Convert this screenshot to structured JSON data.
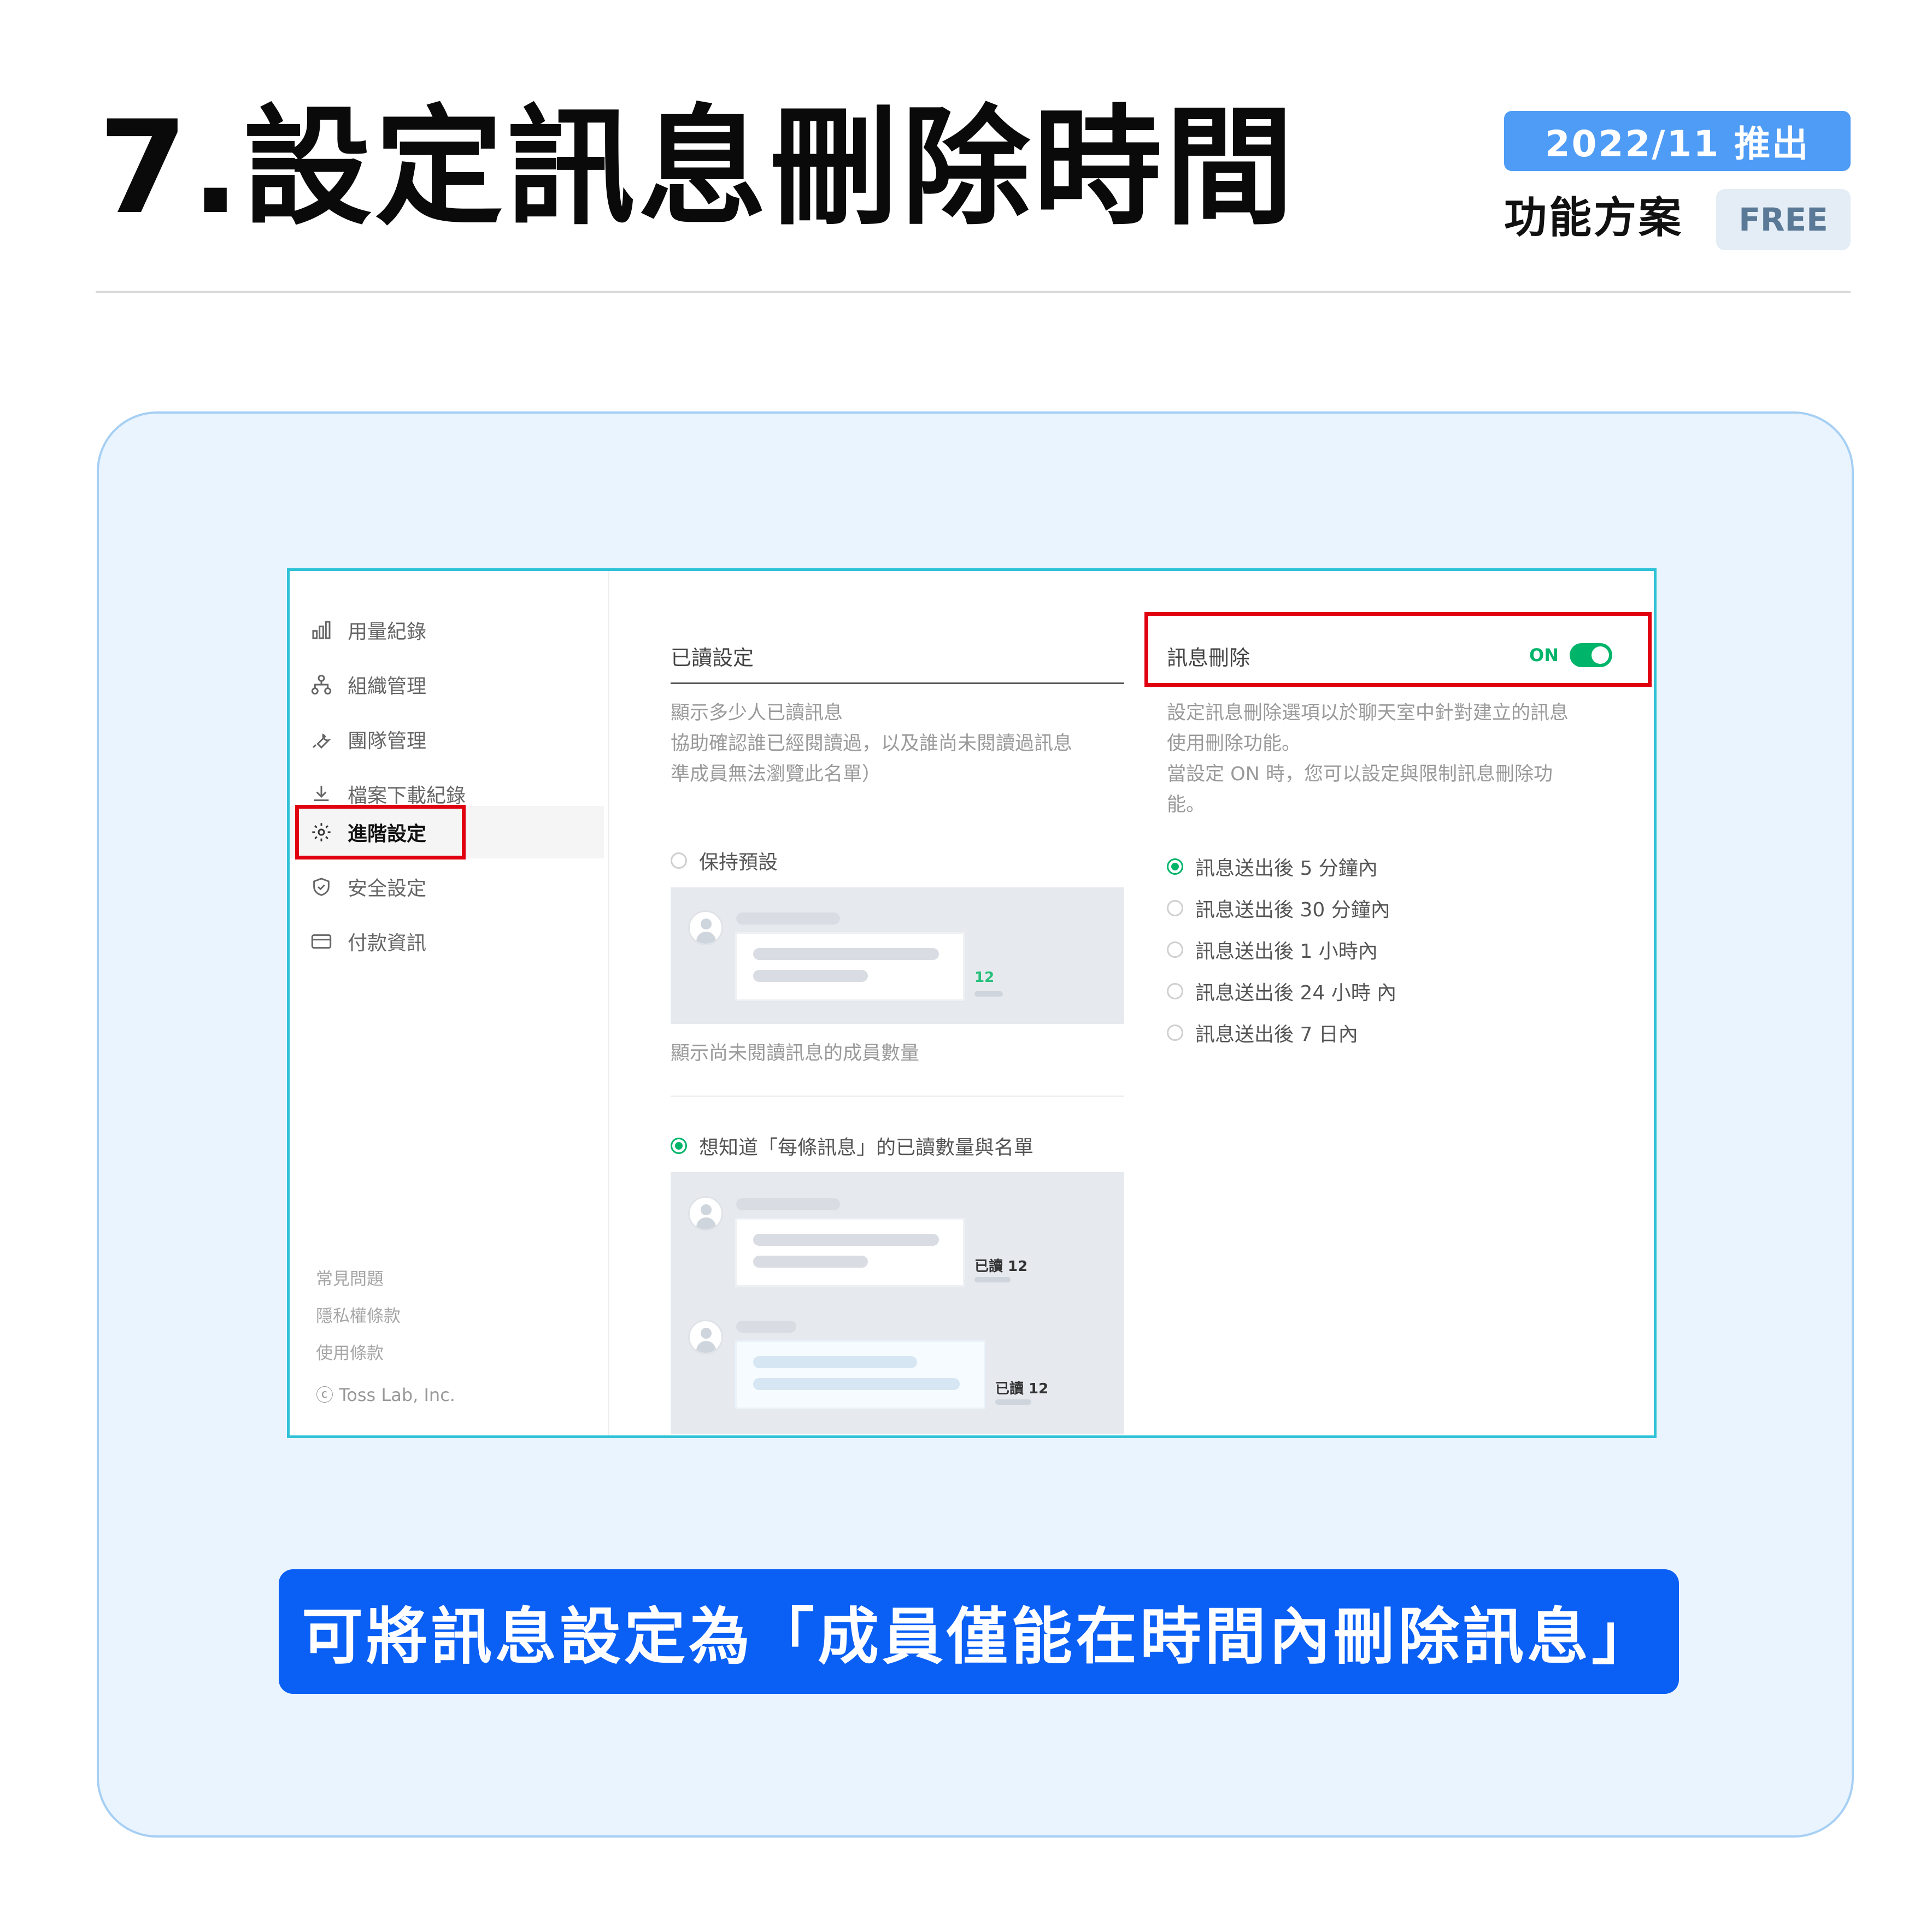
{
  "header": {
    "title": "7.設定訊息刪除時間",
    "release_badge": "2022/11 推出",
    "plan_label": "功能方案",
    "plan_badge": "FREE"
  },
  "sidebar": {
    "items": [
      {
        "label": "用量紀錄",
        "icon": "bar-chart-icon"
      },
      {
        "label": "組織管理",
        "icon": "org-chart-icon"
      },
      {
        "label": "團隊管理",
        "icon": "wrench-icon"
      },
      {
        "label": "檔案下載紀錄",
        "icon": "download-icon"
      },
      {
        "label": "進階設定",
        "icon": "gear-icon"
      },
      {
        "label": "安全設定",
        "icon": "shield-icon"
      },
      {
        "label": "付款資訊",
        "icon": "credit-card-icon"
      }
    ],
    "active_index": 4,
    "footer_links": [
      "常見問題",
      "隱私權條款",
      "使用條款"
    ],
    "copyright": "ⓒ Toss Lab, Inc."
  },
  "read_settings": {
    "title": "已讀設定",
    "description": [
      "顯示多少人已讀訊息",
      "協助確認誰已經閱讀過，以及誰尚未閱讀過訊息",
      "準成員無法瀏覽此名單）"
    ],
    "option_default": {
      "label": "保持預設",
      "selected": false
    },
    "default_preview_count": "12",
    "default_caption": "顯示尚未閱讀訊息的成員數量",
    "option_detail": {
      "label": "想知道「每條訊息」的已讀數量與名單",
      "selected": true
    },
    "detail_preview_count_1": "已讀 12",
    "detail_preview_count_2": "已讀 12"
  },
  "message_delete": {
    "title": "訊息刪除",
    "toggle_label": "ON",
    "toggle_on": true,
    "description": [
      "設定訊息刪除選項以於聊天室中針對建立的訊息",
      "使用刪除功能。",
      "當設定 ON 時，您可以設定與限制訊息刪除功",
      "能。"
    ],
    "options": [
      {
        "label": "訊息送出後 5 分鐘內",
        "selected": true
      },
      {
        "label": "訊息送出後 30 分鐘內",
        "selected": false
      },
      {
        "label": "訊息送出後 1 小時內",
        "selected": false
      },
      {
        "label": "訊息送出後 24 小時 內",
        "selected": false
      },
      {
        "label": "訊息送出後 7 日內",
        "selected": false
      }
    ]
  },
  "caption": "可將訊息設定為「成員僅能在時間內刪除訊息」",
  "colors": {
    "accent_blue": "#0a5ff4",
    "badge_blue": "#4f9cf6",
    "highlight_red": "#e00010",
    "toggle_green": "#00b46a",
    "stage_bg": "#eaf4ff"
  }
}
